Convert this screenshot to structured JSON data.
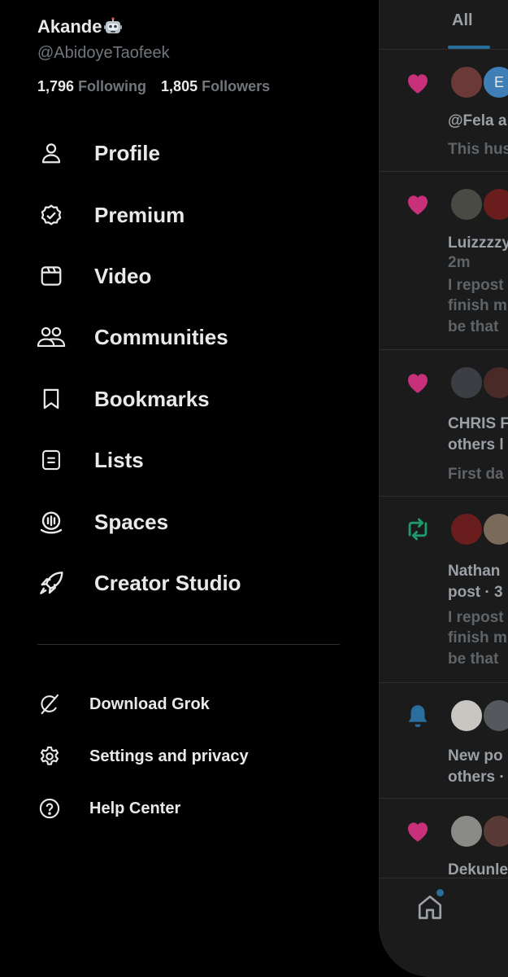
{
  "profile": {
    "display_name": "Akande",
    "handle": "@AbidoyeTaofeek",
    "following_count": "1,796",
    "following_label": "Following",
    "followers_count": "1,805",
    "followers_label": "Followers"
  },
  "nav": [
    {
      "label": "Profile",
      "icon": "person-icon"
    },
    {
      "label": "Premium",
      "icon": "verified-badge-icon"
    },
    {
      "label": "Video",
      "icon": "video-icon"
    },
    {
      "label": "Communities",
      "icon": "communities-icon"
    },
    {
      "label": "Bookmarks",
      "icon": "bookmark-icon"
    },
    {
      "label": "Lists",
      "icon": "list-icon"
    },
    {
      "label": "Spaces",
      "icon": "spaces-icon"
    },
    {
      "label": "Creator Studio",
      "icon": "rocket-icon"
    }
  ],
  "secondary": [
    {
      "label": "Download Grok",
      "icon": "grok-icon"
    },
    {
      "label": "Settings and privacy",
      "icon": "gear-icon"
    },
    {
      "label": "Help Center",
      "icon": "help-icon"
    }
  ],
  "panel": {
    "tab_all": "All",
    "notifications": [
      {
        "type": "like",
        "line1": "@Fela a",
        "line2": "",
        "line3": "This hus"
      },
      {
        "type": "like",
        "line1": "Luizzzzy",
        "line2": "2m",
        "line3": "I repost",
        "line4": "finish m",
        "line5": "be that"
      },
      {
        "type": "like",
        "line1": "CHRIS F",
        "line2": "others l",
        "line3": "First da"
      },
      {
        "type": "repost",
        "line1": "Nathan",
        "line2": "post · 3",
        "line3": "I repost",
        "line4": "finish m",
        "line5": "be that"
      },
      {
        "type": "bell",
        "line1": "New po",
        "line2": "others ·"
      },
      {
        "type": "like",
        "line1": "Dekunle"
      }
    ],
    "avatar_letter": "E"
  },
  "colors": {
    "background": "#000000",
    "text": "#e7e9ea",
    "muted": "#71767b",
    "like": "#c8317a",
    "repost": "#1f9a6c",
    "bell": "#2a6e9e"
  }
}
